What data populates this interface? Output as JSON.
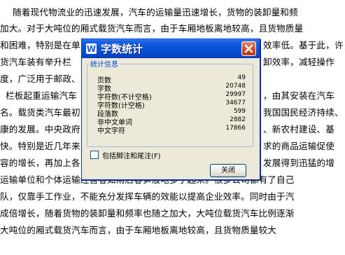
{
  "document": {
    "lines": [
      "随着现代物流业的迅速发展，汽车的运输量迅速增长，货物的装卸量和频",
      "加大。对于大吨位的厢式载货汽车而言，由于车厢地板离地较高，且货物质量",
      "和困难，特别是在单",
      "货汽车装有举升栏",
      "度，广泛用于邮政、",
      "栏板起重运输汽车",
      "名。载货类汽车最初",
      "康的发展。中央政府",
      "快。特别是近几年来",
      "容的增长，再加上各",
      "运输单位和个体运输经营者如雨后春笋般地多了起来。很多公司都有了自己",
      "队，仅靠手工作业，不能充分发挥车辆的效能以提高企业效率。同时由于汽",
      "成倍增长，随着货物的装卸量和频率也随之加大，大吨位载货汽车比例逐渐",
      "大吨位的厢式载货汽车而言，由于车厢地板离地较高，且货物质量较大"
    ],
    "right_fragments": [
      "效率低。基于此，许",
      "卸效率，减轻操作",
      "，由其安装在汽车",
      "我国国民经济持续、",
      "、新农村建设、基",
      "求的商品运输促使",
      "发展得到迅猛的增"
    ]
  },
  "dialog": {
    "title": "字数统计",
    "group_label": "统计信息",
    "stats": [
      {
        "label": "页数",
        "value": "49"
      },
      {
        "label": "字数",
        "value": "20748"
      },
      {
        "label": "字符数(不计空格)",
        "value": "29997"
      },
      {
        "label": "字符数(计空格)",
        "value": "34677"
      },
      {
        "label": "段落数",
        "value": "599"
      },
      {
        "label": "非中文单词",
        "value": "2882"
      },
      {
        "label": "中文字符",
        "value": "17866"
      }
    ],
    "checkbox_label": "包括脚注和尾注(F)",
    "checkbox_checked": false,
    "close_button": "关闭"
  },
  "colors": {
    "titlebar": "#0a56d8",
    "close_red": "#cf4a2c",
    "dialog_bg": "#ece9d8",
    "group_label": "#0046d5"
  }
}
